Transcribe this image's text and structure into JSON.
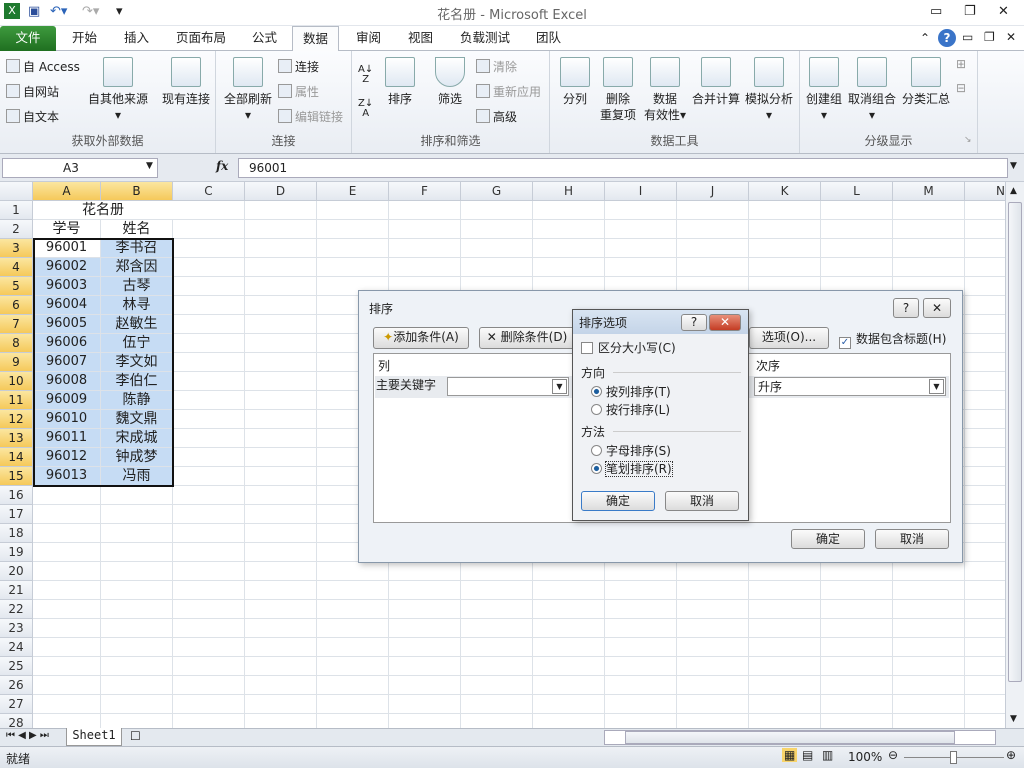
{
  "window": {
    "title": "花名册 - Microsoft Excel"
  },
  "tabs": [
    "文件",
    "开始",
    "插入",
    "页面布局",
    "公式",
    "数据",
    "审阅",
    "视图",
    "负载测试",
    "团队"
  ],
  "ribbon": {
    "get_external": {
      "label": "获取外部数据",
      "access": "自 Access",
      "web": "自网站",
      "text": "自文本",
      "other": "自其他来源",
      "existing": "现有连接"
    },
    "connections": {
      "label": "连接",
      "refresh_all": "全部刷新",
      "connections": "连接",
      "properties": "属性",
      "edit_links": "编辑链接"
    },
    "sort_filter": {
      "label": "排序和筛选",
      "sort": "排序",
      "filter": "筛选",
      "clear": "清除",
      "reapply": "重新应用",
      "advanced": "高级"
    },
    "data_tools": {
      "label": "数据工具",
      "split": "分列",
      "remove_dup_1": "删除",
      "remove_dup_2": "重复项",
      "validation_1": "数据",
      "validation_2": "有效性",
      "consolidate": "合并计算",
      "whatif": "模拟分析"
    },
    "outline": {
      "label": "分级显示",
      "group": "创建组",
      "ungroup": "取消组合",
      "subtotal": "分类汇总"
    }
  },
  "formula_bar": {
    "name_box": "A3",
    "fx": "fx",
    "value": "96001"
  },
  "columns": [
    "A",
    "B",
    "C",
    "D",
    "E",
    "F",
    "G",
    "H",
    "I",
    "J",
    "K",
    "L",
    "M",
    "N"
  ],
  "rows": [
    "1",
    "2",
    "3",
    "4",
    "5",
    "6",
    "7",
    "8",
    "9",
    "10",
    "11",
    "12",
    "13",
    "14",
    "15",
    "16",
    "17",
    "18",
    "19",
    "20",
    "21",
    "22",
    "23",
    "24",
    "25",
    "26",
    "27",
    "28"
  ],
  "sheet": {
    "title": "花名册",
    "headers": [
      "学号",
      "姓名"
    ],
    "records": [
      [
        "96001",
        "李书召"
      ],
      [
        "96002",
        "郑含因"
      ],
      [
        "96003",
        "古琴"
      ],
      [
        "96004",
        "林寻"
      ],
      [
        "96005",
        "赵敏生"
      ],
      [
        "96006",
        "伍宁"
      ],
      [
        "96007",
        "李文如"
      ],
      [
        "96008",
        "李伯仁"
      ],
      [
        "96009",
        "陈静"
      ],
      [
        "96010",
        "魏文鼎"
      ],
      [
        "96011",
        "宋成城"
      ],
      [
        "96012",
        "钟成梦"
      ],
      [
        "96013",
        "冯雨"
      ]
    ]
  },
  "sheet_tabs": [
    "Sheet1"
  ],
  "status": {
    "ready": "就绪",
    "zoom": "100%"
  },
  "sort_dialog": {
    "title": "排序",
    "add": "添加条件(A)",
    "delete": "删除条件(D)",
    "options": "选项(O)...",
    "has_header": "数据包含标题(H)",
    "col_header": "列",
    "order_header": "次序",
    "primary_key": "主要关键字",
    "order_value": "升序",
    "ok": "确定",
    "cancel": "取消"
  },
  "options_dialog": {
    "title": "排序选项",
    "case": "区分大小写(C)",
    "direction": "方向",
    "by_column": "按列排序(T)",
    "by_row": "按行排序(L)",
    "method": "方法",
    "alpha": "字母排序(S)",
    "stroke": "笔划排序(R)",
    "ok": "确定",
    "cancel": "取消"
  }
}
